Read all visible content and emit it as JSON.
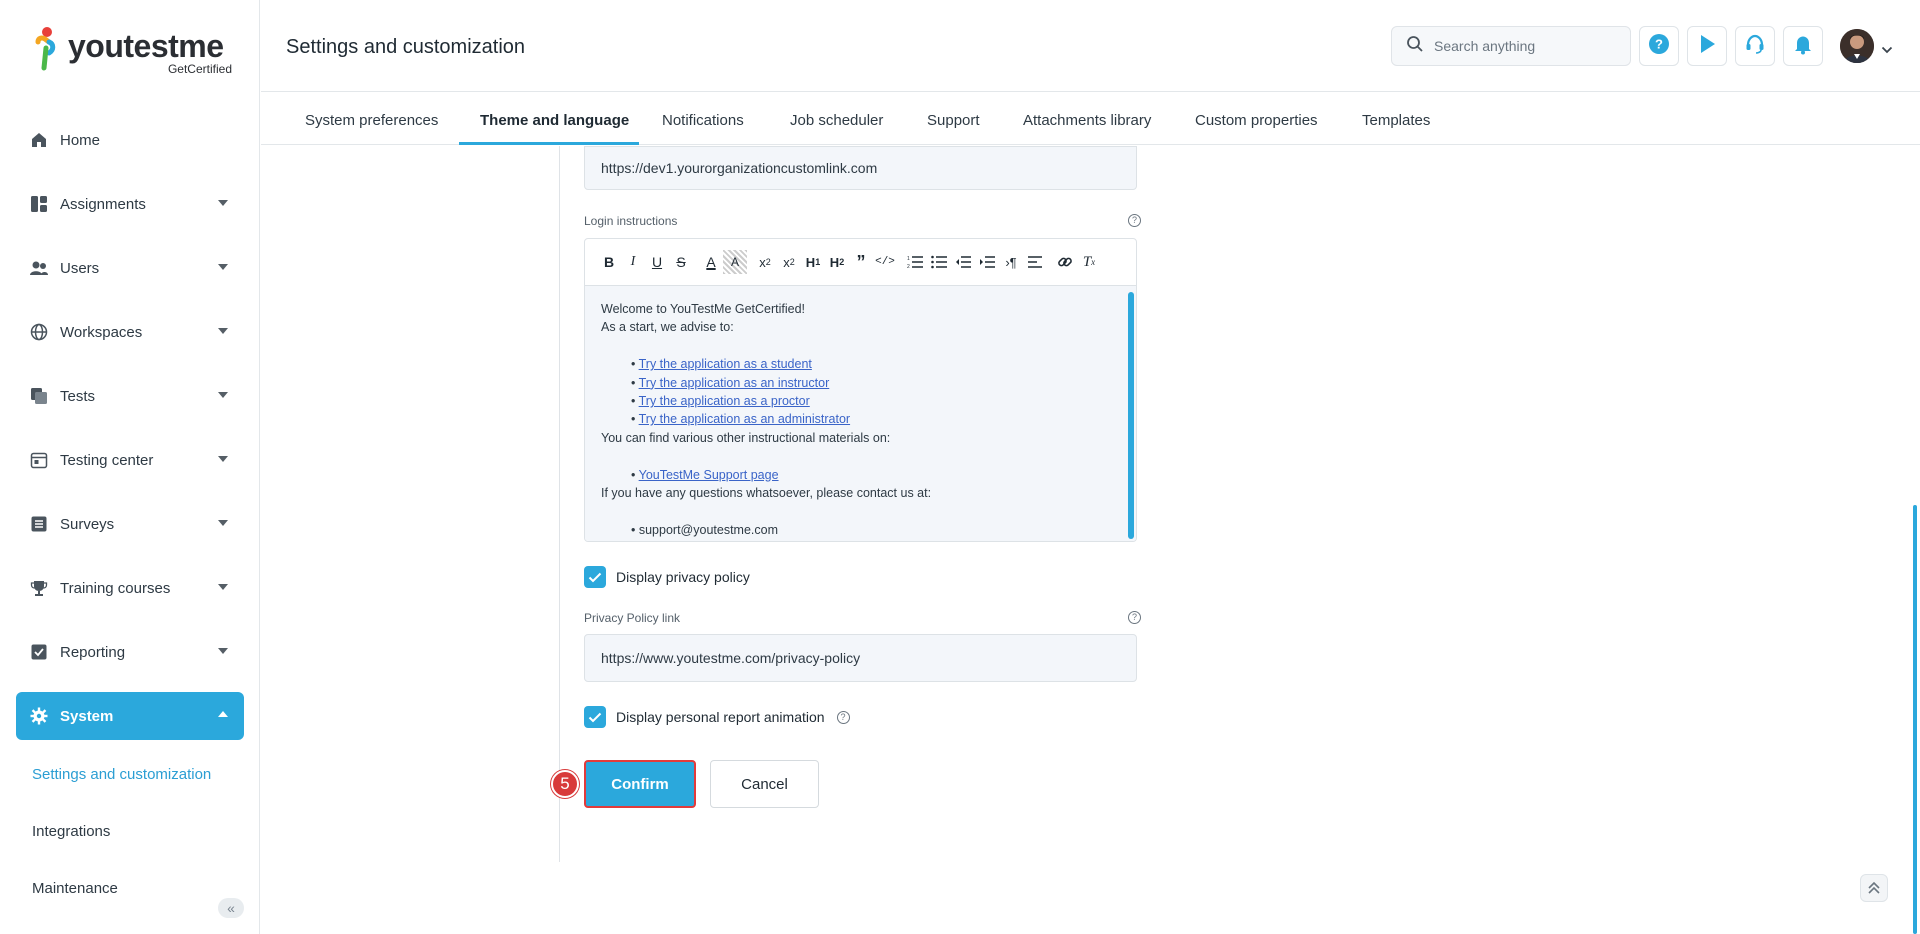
{
  "brand": {
    "name_prefix": "you",
    "name_mid": "test",
    "name_suffix": "me",
    "subtitle": "GetCertified",
    "accent": "#2ba8dc"
  },
  "sidebar": {
    "items": [
      {
        "label": "Home",
        "icon": "home-icon"
      },
      {
        "label": "Assignments",
        "icon": "assignments-icon"
      },
      {
        "label": "Users",
        "icon": "users-icon"
      },
      {
        "label": "Workspaces",
        "icon": "globe-icon"
      },
      {
        "label": "Tests",
        "icon": "tests-icon"
      },
      {
        "label": "Testing center",
        "icon": "calendar-icon"
      },
      {
        "label": "Surveys",
        "icon": "surveys-icon"
      },
      {
        "label": "Training courses",
        "icon": "trophy-icon"
      },
      {
        "label": "Reporting",
        "icon": "reporting-icon"
      },
      {
        "label": "System",
        "icon": "gear-icon"
      }
    ],
    "sub_items": [
      {
        "label": "Settings and customization"
      },
      {
        "label": "Integrations"
      },
      {
        "label": "Maintenance"
      }
    ]
  },
  "header": {
    "title": "Settings and customization",
    "search_placeholder": "Search anything"
  },
  "tabs": [
    {
      "label": "System preferences"
    },
    {
      "label": "Theme and language"
    },
    {
      "label": "Notifications"
    },
    {
      "label": "Job scheduler"
    },
    {
      "label": "Support"
    },
    {
      "label": "Attachments library"
    },
    {
      "label": "Custom properties"
    },
    {
      "label": "Templates"
    }
  ],
  "form": {
    "custom_link_value": "https://dev1.yourorganizationcustomlink.com",
    "login_instructions_label": "Login instructions",
    "editor": {
      "line1": "Welcome to YouTestMe GetCertified!",
      "line2": "As a start, we advise to:",
      "links": [
        "Try the application as a student",
        "Try the application as an instructor",
        "Try the application as a proctor",
        "Try the application as an administrator"
      ],
      "line3": "You can find various other instructional materials on:",
      "support_link": "YouTestMe Support page",
      "line4": "If you have any questions whatsoever, please contact us at:",
      "email": "support@youtestme.com"
    },
    "display_privacy_label": "Display privacy policy",
    "privacy_link_label": "Privacy Policy link",
    "privacy_link_value": "https://www.youtestme.com/privacy-policy",
    "display_animation_label": "Display personal report animation",
    "confirm_label": "Confirm",
    "cancel_label": "Cancel",
    "step_number": "5"
  }
}
